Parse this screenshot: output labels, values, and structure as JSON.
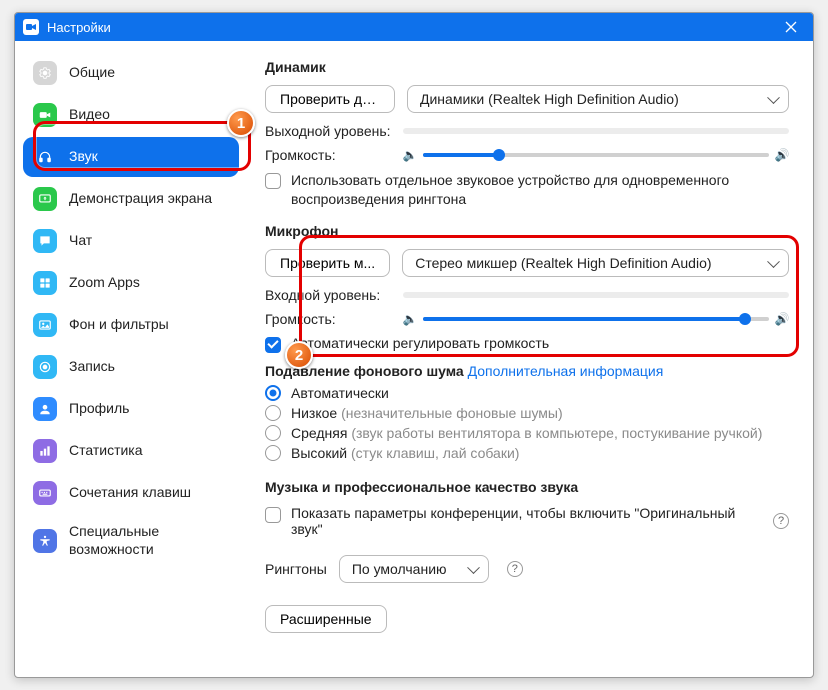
{
  "window": {
    "title": "Настройки"
  },
  "sidebar": {
    "items": [
      {
        "label": "Общие",
        "icon": "gear-icon",
        "color": "#d6d6d6"
      },
      {
        "label": "Видео",
        "icon": "video-icon",
        "color": "#2AC84B"
      },
      {
        "label": "Звук",
        "icon": "headphones-icon",
        "color": "#ffffff",
        "active": true
      },
      {
        "label": "Демонстрация экрана",
        "icon": "share-screen-icon",
        "color": "#2AC84B"
      },
      {
        "label": "Чат",
        "icon": "chat-icon",
        "color": "#30B8F5"
      },
      {
        "label": "Zoom Apps",
        "icon": "apps-icon",
        "color": "#30B8F5"
      },
      {
        "label": "Фон и фильтры",
        "icon": "background-icon",
        "color": "#30B8F5"
      },
      {
        "label": "Запись",
        "icon": "record-icon",
        "color": "#30B8F5"
      },
      {
        "label": "Профиль",
        "icon": "profile-icon",
        "color": "#2F8CFF"
      },
      {
        "label": "Статистика",
        "icon": "stats-icon",
        "color": "#8E6CE4"
      },
      {
        "label": "Сочетания клавиш",
        "icon": "keyboard-icon",
        "color": "#8E6CE4"
      },
      {
        "label": "Специальные возможности",
        "icon": "accessibility-icon",
        "color": "#5075E6"
      }
    ]
  },
  "speaker": {
    "title": "Динамик",
    "test_btn": "Проверить ди...",
    "device": "Динамики (Realtek High Definition Audio)",
    "output_level_label": "Выходной уровень:",
    "volume_label": "Громкость:",
    "volume_percent": 22,
    "separate_device_label": "Использовать отдельное звуковое устройство для одновременного воспроизведения рингтона",
    "separate_device_checked": false
  },
  "mic": {
    "title": "Микрофон",
    "test_btn": "Проверить м...",
    "device": "Стерео микшер (Realtek High Definition Audio)",
    "input_level_label": "Входной уровень:",
    "volume_label": "Громкость:",
    "volume_percent": 93,
    "auto_adjust_label": "Автоматически регулировать громкость",
    "auto_adjust_checked": true
  },
  "noise": {
    "title": "Подавление фонового шума",
    "more_info": "Дополнительная информация",
    "selected": 0,
    "options": [
      {
        "label": "Автоматически",
        "hint": ""
      },
      {
        "label": "Низкое",
        "hint": "(незначительные фоновые шумы)"
      },
      {
        "label": "Средняя",
        "hint": "(звук работы вентилятора в компьютере, постукивание ручкой)"
      },
      {
        "label": "Высокий",
        "hint": "(стук клавиш, лай собаки)"
      }
    ]
  },
  "music": {
    "title": "Музыка и профессиональное качество звука",
    "show_original_label": "Показать параметры конференции, чтобы включить \"Оригинальный звук\"",
    "show_original_checked": false
  },
  "ringtone": {
    "label": "Рингтоны",
    "value": "По умолчанию"
  },
  "advanced_btn": "Расширенные",
  "annotations": {
    "badge1": "1",
    "badge2": "2"
  }
}
